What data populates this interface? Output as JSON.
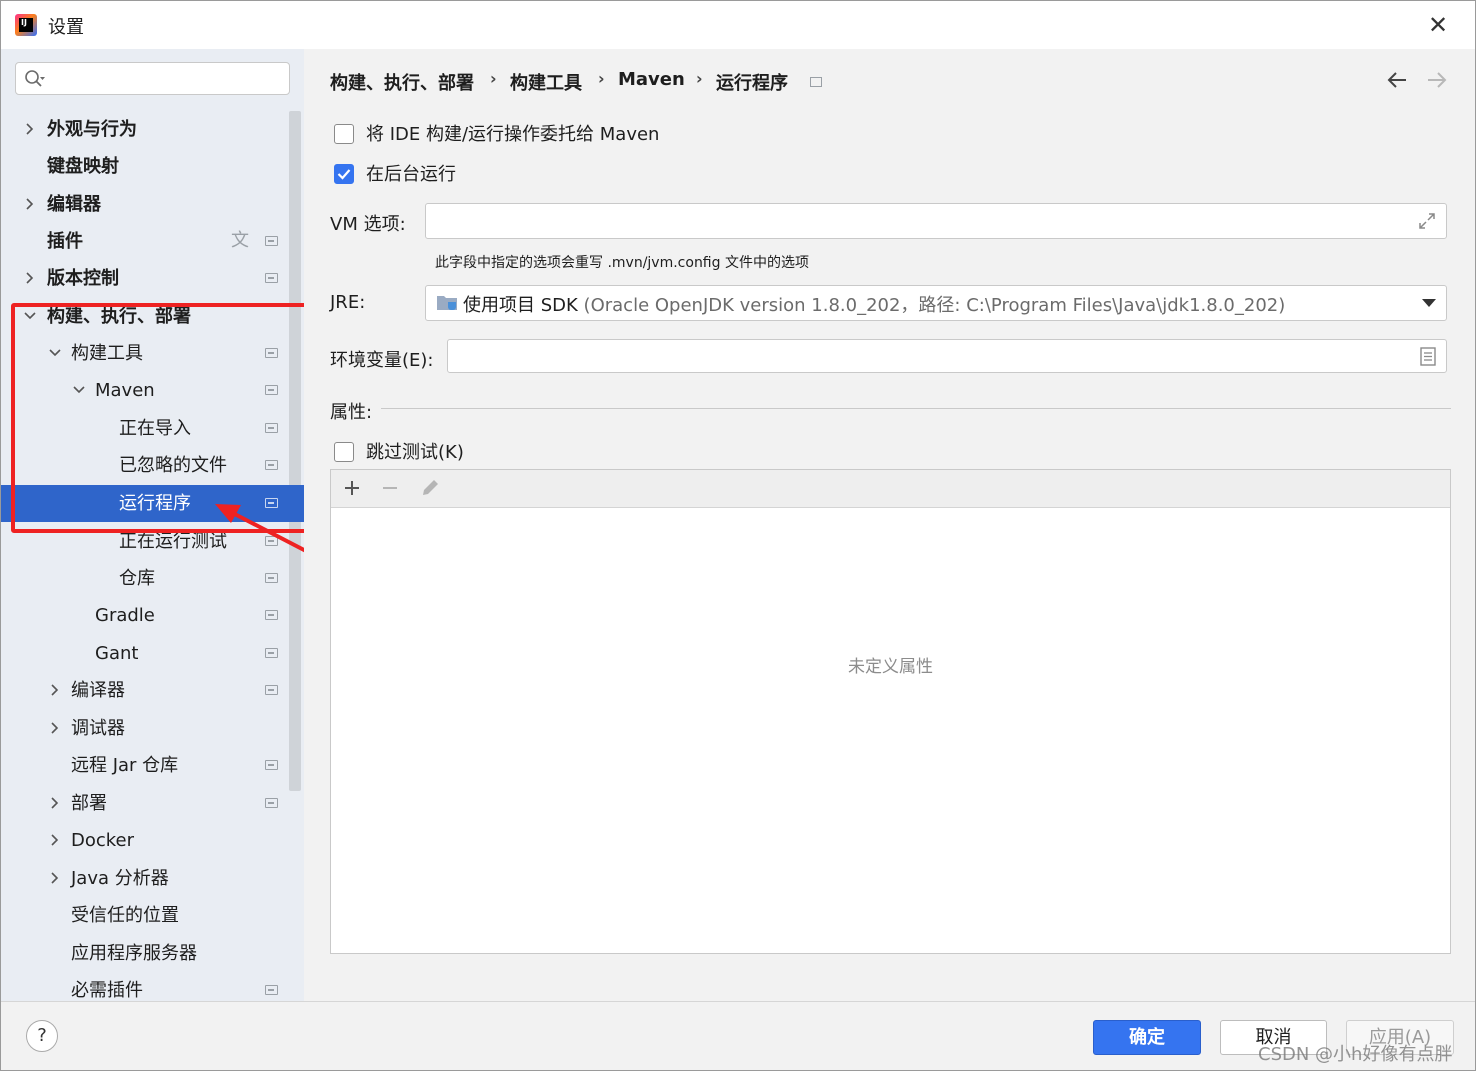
{
  "window": {
    "title": "设置",
    "close_glyph": "✕",
    "app_icon_text": "IJ"
  },
  "sidebar": {
    "search": {
      "placeholder": "",
      "value": ""
    },
    "items": [
      {
        "label": "外观与行为",
        "expandable": true,
        "expanded": false,
        "bold": true
      },
      {
        "label": "键盘映射",
        "expandable": false,
        "bold": true
      },
      {
        "label": "编辑器",
        "expandable": true,
        "expanded": false,
        "bold": true
      },
      {
        "label": "插件",
        "expandable": false,
        "bold": true
      },
      {
        "label": "版本控制",
        "expandable": true,
        "expanded": false,
        "bold": true
      },
      {
        "label": "构建、执行、部署",
        "expandable": true,
        "expanded": true,
        "bold": true
      },
      {
        "label": "构建工具",
        "expandable": true,
        "expanded": true
      },
      {
        "label": "Maven",
        "expandable": true,
        "expanded": true
      },
      {
        "label": "正在导入"
      },
      {
        "label": "已忽略的文件"
      },
      {
        "label": "运行程序",
        "selected": true
      },
      {
        "label": "正在运行测试"
      },
      {
        "label": "仓库"
      },
      {
        "label": "Gradle"
      },
      {
        "label": "Gant"
      },
      {
        "label": "编译器",
        "expandable": true,
        "expanded": false
      },
      {
        "label": "调试器",
        "expandable": true,
        "expanded": false
      },
      {
        "label": "远程 Jar 仓库"
      },
      {
        "label": "部署",
        "expandable": true,
        "expanded": false
      },
      {
        "label": "Docker",
        "expandable": true,
        "expanded": false
      },
      {
        "label": "Java 分析器",
        "expandable": true,
        "expanded": false
      },
      {
        "label": "受信任的位置"
      },
      {
        "label": "应用程序服务器"
      },
      {
        "label": "必需插件"
      }
    ]
  },
  "breadcrumb": {
    "items": [
      "构建、执行、部署",
      "构建工具",
      "Maven",
      "运行程序"
    ],
    "separator": "›"
  },
  "form": {
    "delegate_checkbox": {
      "label": "将 IDE 构建/运行操作委托给 Maven",
      "checked": false
    },
    "background_checkbox": {
      "label": "在后台运行",
      "checked": true
    },
    "vm_options": {
      "label": "VM 选项:",
      "value": "",
      "hint": "此字段中指定的选项会重写 .mvn/jvm.config 文件中的选项"
    },
    "jre": {
      "label": "JRE:",
      "value": "使用项目 SDK",
      "detail": "(Oracle OpenJDK version 1.8.0_202，路径: C:\\Program Files\\Java\\jdk1.8.0_202)"
    },
    "env_vars": {
      "label": "环境变量(E):",
      "value": ""
    },
    "properties": {
      "label": "属性:",
      "empty_text": "未定义属性"
    },
    "skip_tests_checkbox": {
      "label": "跳过测试(K)",
      "checked": false
    }
  },
  "footer": {
    "help": "?",
    "ok": "确定",
    "cancel": "取消",
    "apply": "应用(A)"
  },
  "watermark": "CSDN @小h好像有点胖",
  "colors": {
    "accent": "#3574f0",
    "selection": "#2f65ca",
    "annotation_red": "#ee2222"
  }
}
